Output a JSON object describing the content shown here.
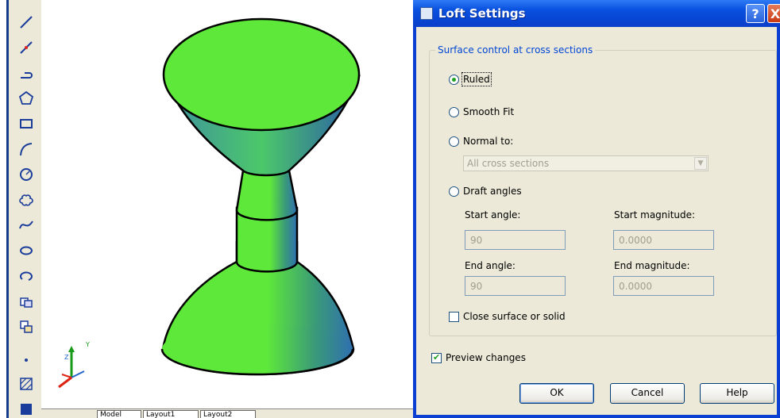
{
  "cad": {
    "tools": [
      {
        "name": "line-icon"
      },
      {
        "name": "construction-line-icon"
      },
      {
        "name": "polyline-icon"
      },
      {
        "name": "polygon-icon"
      },
      {
        "name": "rectangle-icon"
      },
      {
        "name": "arc-icon"
      },
      {
        "name": "circle-icon"
      },
      {
        "name": "revision-cloud-icon"
      },
      {
        "name": "spline-icon"
      },
      {
        "name": "ellipse-icon"
      },
      {
        "name": "ellipse-arc-icon"
      },
      {
        "name": "insert-block-icon"
      },
      {
        "name": "make-block-icon"
      },
      {
        "name": "point-icon"
      },
      {
        "name": "hatch-icon"
      },
      {
        "name": "gradient-icon"
      }
    ],
    "surface_color": "#5ee83a",
    "shade_color": "#2f6fb0",
    "ucs": {
      "z_label": "Z",
      "y_label": "Y"
    },
    "tabs": [
      "Model",
      "Layout1",
      "Layout2"
    ]
  },
  "dialog": {
    "title": "Loft Settings",
    "help_icon_label": "?",
    "close_icon_label": "X",
    "group_title": "Surface control at cross sections",
    "options": {
      "ruled": {
        "label": "Ruled",
        "selected": true
      },
      "smooth_fit": {
        "label": "Smooth Fit",
        "selected": false
      },
      "normal_to": {
        "label": "Normal to:",
        "selected": false
      },
      "draft_angles": {
        "label": "Draft angles",
        "selected": false
      }
    },
    "normal_to_select": {
      "value": "All cross sections"
    },
    "start_angle": {
      "label": "Start angle:",
      "value": "90"
    },
    "start_magnitude": {
      "label": "Start magnitude:",
      "value": "0.0000"
    },
    "end_angle": {
      "label": "End angle:",
      "value": "90"
    },
    "end_magnitude": {
      "label": "End magnitude:",
      "value": "0.0000"
    },
    "close_surface": {
      "label": "Close surface or solid",
      "checked": false
    },
    "preview_changes": {
      "label": "Preview changes",
      "checked": true
    },
    "buttons": {
      "ok": "OK",
      "cancel": "Cancel",
      "help": "Help"
    }
  }
}
